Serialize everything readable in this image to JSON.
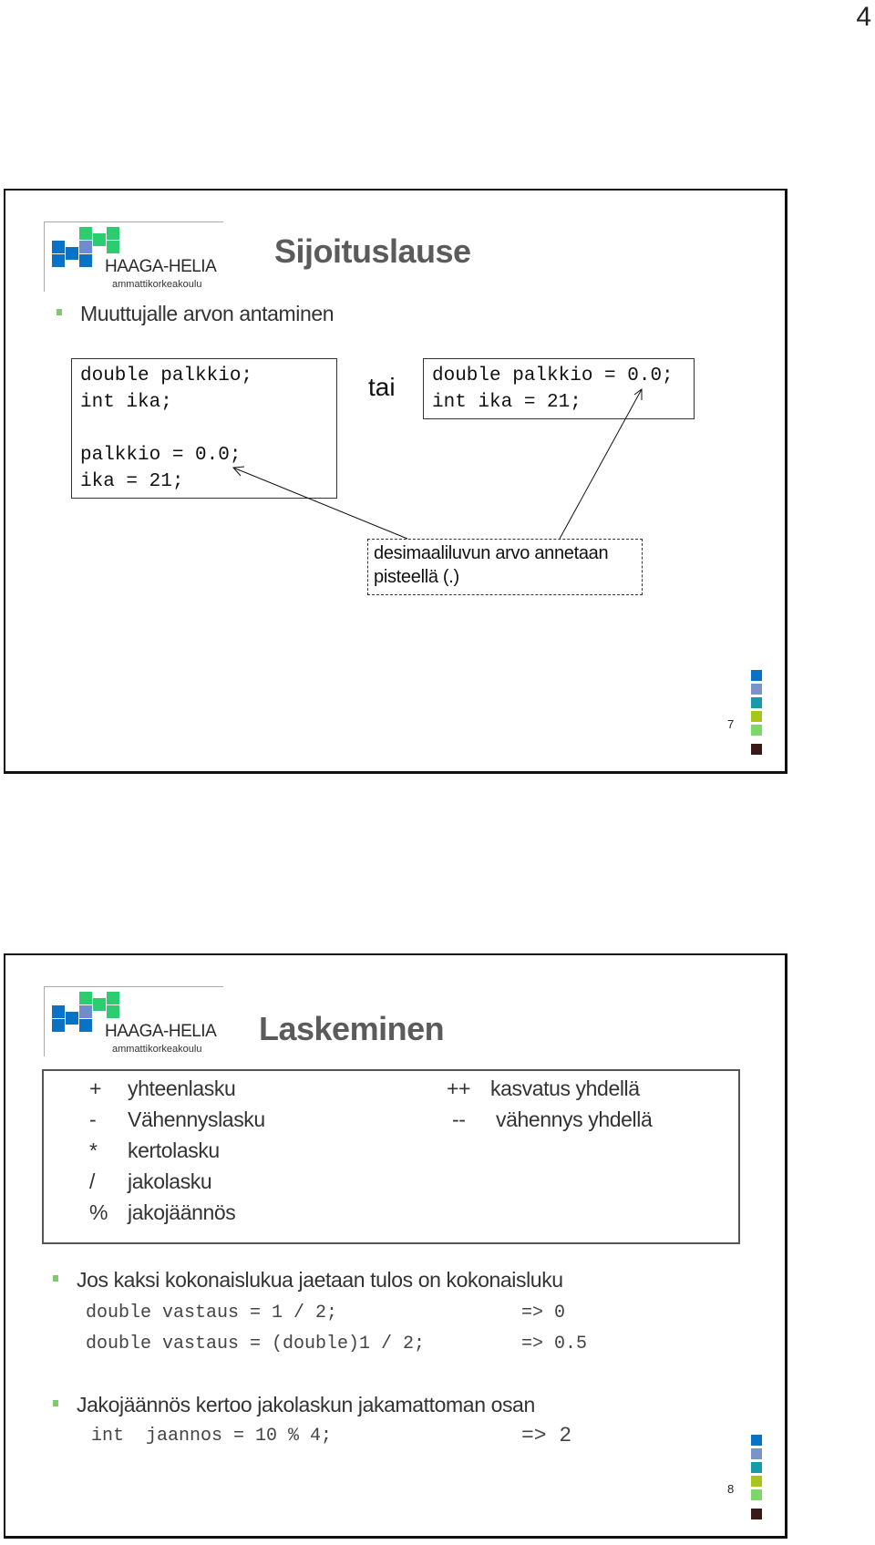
{
  "page_number": "4",
  "logo": {
    "name": "HAAGA-HELIA",
    "subtitle": "ammattikorkeakoulu"
  },
  "slide7": {
    "title": "Sijoituslause",
    "bullet": "Muuttujalle arvon antaminen",
    "code_left": [
      "double palkkio;",
      "int ika;",
      "",
      "palkkio = 0.0;",
      "ika = 21;"
    ],
    "or_label": "tai",
    "code_right": [
      "double palkkio = 0.0;",
      "int ika = 21;"
    ],
    "note": [
      "desimaaliluvun arvo annetaan",
      "pisteellä (.)"
    ],
    "slide_number": "7"
  },
  "slide8": {
    "title": "Laskeminen",
    "operators_left": [
      {
        "symbol": "+",
        "label": "yhteenlasku"
      },
      {
        "symbol": "-",
        "label": "Vähennyslasku"
      },
      {
        "symbol": "*",
        "label": "kertolasku"
      },
      {
        "symbol": "/",
        "label": "jakolasku"
      },
      {
        "symbol": "%",
        "label": "jakojäännös"
      }
    ],
    "operators_right": [
      {
        "symbol": "++",
        "label": "kasvatus yhdellä"
      },
      {
        "symbol": "--",
        "label": "vähennys yhdellä"
      }
    ],
    "bullet1": "Jos kaksi kokonaislukua jaetaan tulos on kokonaisluku",
    "code1": [
      {
        "code": "double vastaus = 1 / 2;",
        "result": "=> 0"
      },
      {
        "code": "double vastaus = (double)1 / 2;",
        "result": "=> 0.5"
      }
    ],
    "bullet2": "Jakojäännös kertoo jakolaskun jakamattoman osan",
    "code2": {
      "code": "int  jaannos = 10 % 4;",
      "result": "=> 2"
    },
    "slide_number": "8"
  },
  "colors": {
    "deco": [
      "#0a72c4",
      "#7b94c8",
      "#1a9aa8",
      "#a8c618",
      "#7fd66a",
      "#3a1a18"
    ],
    "logo_blue": "#0a72c4",
    "logo_lavender": "#6f8ccc",
    "logo_green": "#2ecc71",
    "bullet_green": "#7fc870"
  }
}
